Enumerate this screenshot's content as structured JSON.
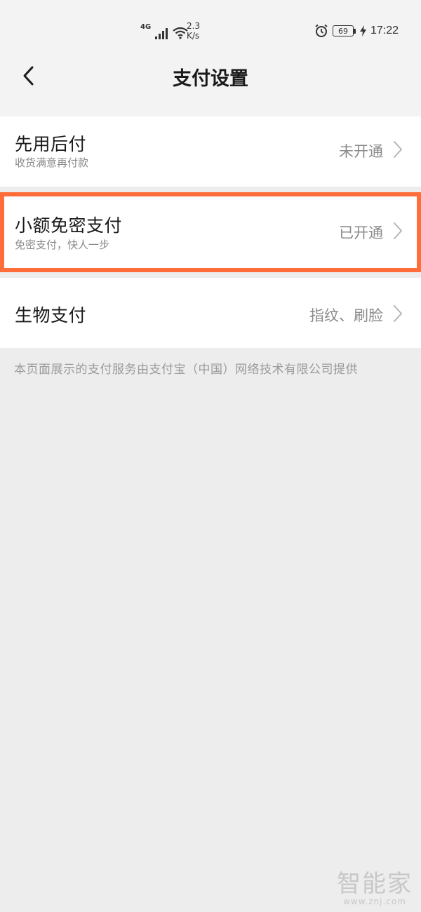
{
  "status_bar": {
    "network": "4G",
    "speed_value": "2.3",
    "speed_unit": "K/s",
    "battery": "69",
    "time": "17:22"
  },
  "nav": {
    "title": "支付设置"
  },
  "rows": [
    {
      "title": "先用后付",
      "subtitle": "收货满意再付款",
      "status": "未开通"
    },
    {
      "title": "小额免密支付",
      "subtitle": "免密支付，快人一步",
      "status": "已开通"
    },
    {
      "title": "生物支付",
      "subtitle": "",
      "status": "指纹、刷脸"
    }
  ],
  "footer": {
    "note": "本页面展示的支付服务由支付宝（中国）网络技术有限公司提供"
  },
  "watermark": {
    "logo": "智能家",
    "url": "www.znj.com"
  },
  "colors": {
    "highlight_border": "#ff6d3a",
    "background": "#ededed",
    "row_background": "#ffffff"
  }
}
